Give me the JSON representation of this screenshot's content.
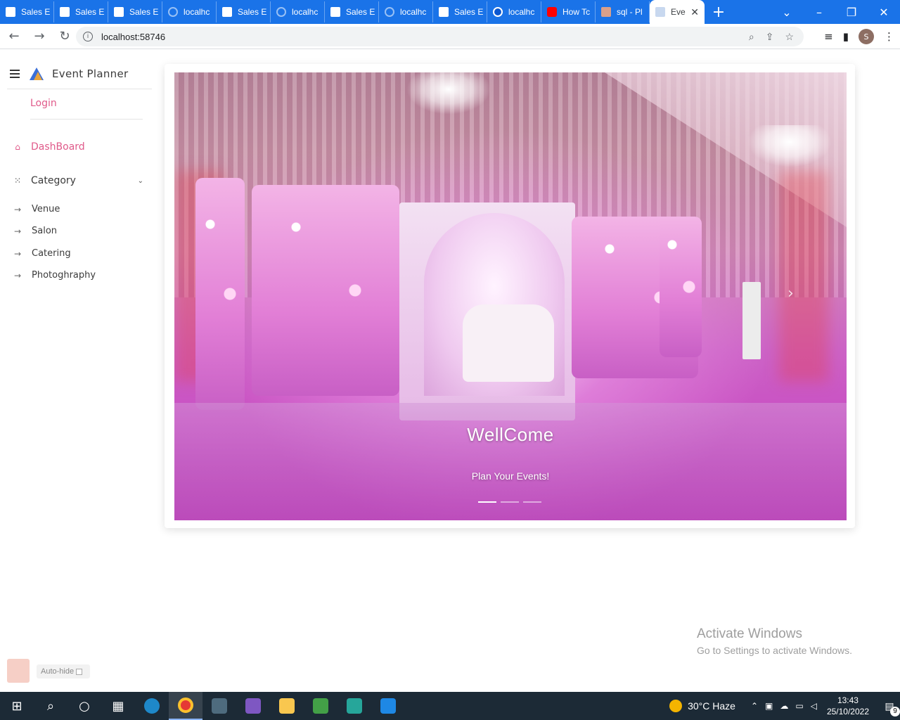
{
  "browser": {
    "tabs": [
      {
        "label": "Sales E",
        "icon": "sales-app-icon"
      },
      {
        "label": "Sales E",
        "icon": "sales-app-icon"
      },
      {
        "label": "Sales E",
        "icon": "sales-app-icon"
      },
      {
        "label": "localhc",
        "icon": "globe-icon"
      },
      {
        "label": "Sales E",
        "icon": "sales-app-icon"
      },
      {
        "label": "localhc",
        "icon": "globe-icon"
      },
      {
        "label": "Sales E",
        "icon": "sales-app-icon"
      },
      {
        "label": "localhc",
        "icon": "globe-icon"
      },
      {
        "label": "Sales E",
        "icon": "sales-app-icon"
      },
      {
        "label": "localhc",
        "icon": "blue-globe-icon"
      },
      {
        "label": "How Tc",
        "icon": "youtube-icon"
      },
      {
        "label": "sql - Pl",
        "icon": "stackoverflow-icon"
      },
      {
        "label": "Eve",
        "icon": "page-icon",
        "active": true
      }
    ],
    "new_tab_glyph": "+",
    "close_tab_glyph": "✕",
    "address": "localhost:58746",
    "profile_initial": "S",
    "accent_color": "#1a73e8"
  },
  "sidebar": {
    "brand_title": "Event Planner",
    "login_label": "Login",
    "dashboard_label": "DashBoard",
    "category_label": "Category",
    "sub_items": [
      {
        "label": "Venue"
      },
      {
        "label": "Salon"
      },
      {
        "label": "Catering"
      },
      {
        "label": "Photoghraphy"
      }
    ],
    "accent_color": "#e05a8a"
  },
  "carousel": {
    "title": "WellCome",
    "subtitle": "Plan Your Events!",
    "slide_count": 3,
    "active_slide": 1
  },
  "watermark": {
    "line1": "Activate Windows",
    "line2": "Go to Settings to activate Windows."
  },
  "widget": {
    "autohide_label": "Auto-hide"
  },
  "taskbar": {
    "weather": "30°C  Haze",
    "time": "13:43",
    "date": "25/10/2022",
    "notification_count": "9"
  }
}
